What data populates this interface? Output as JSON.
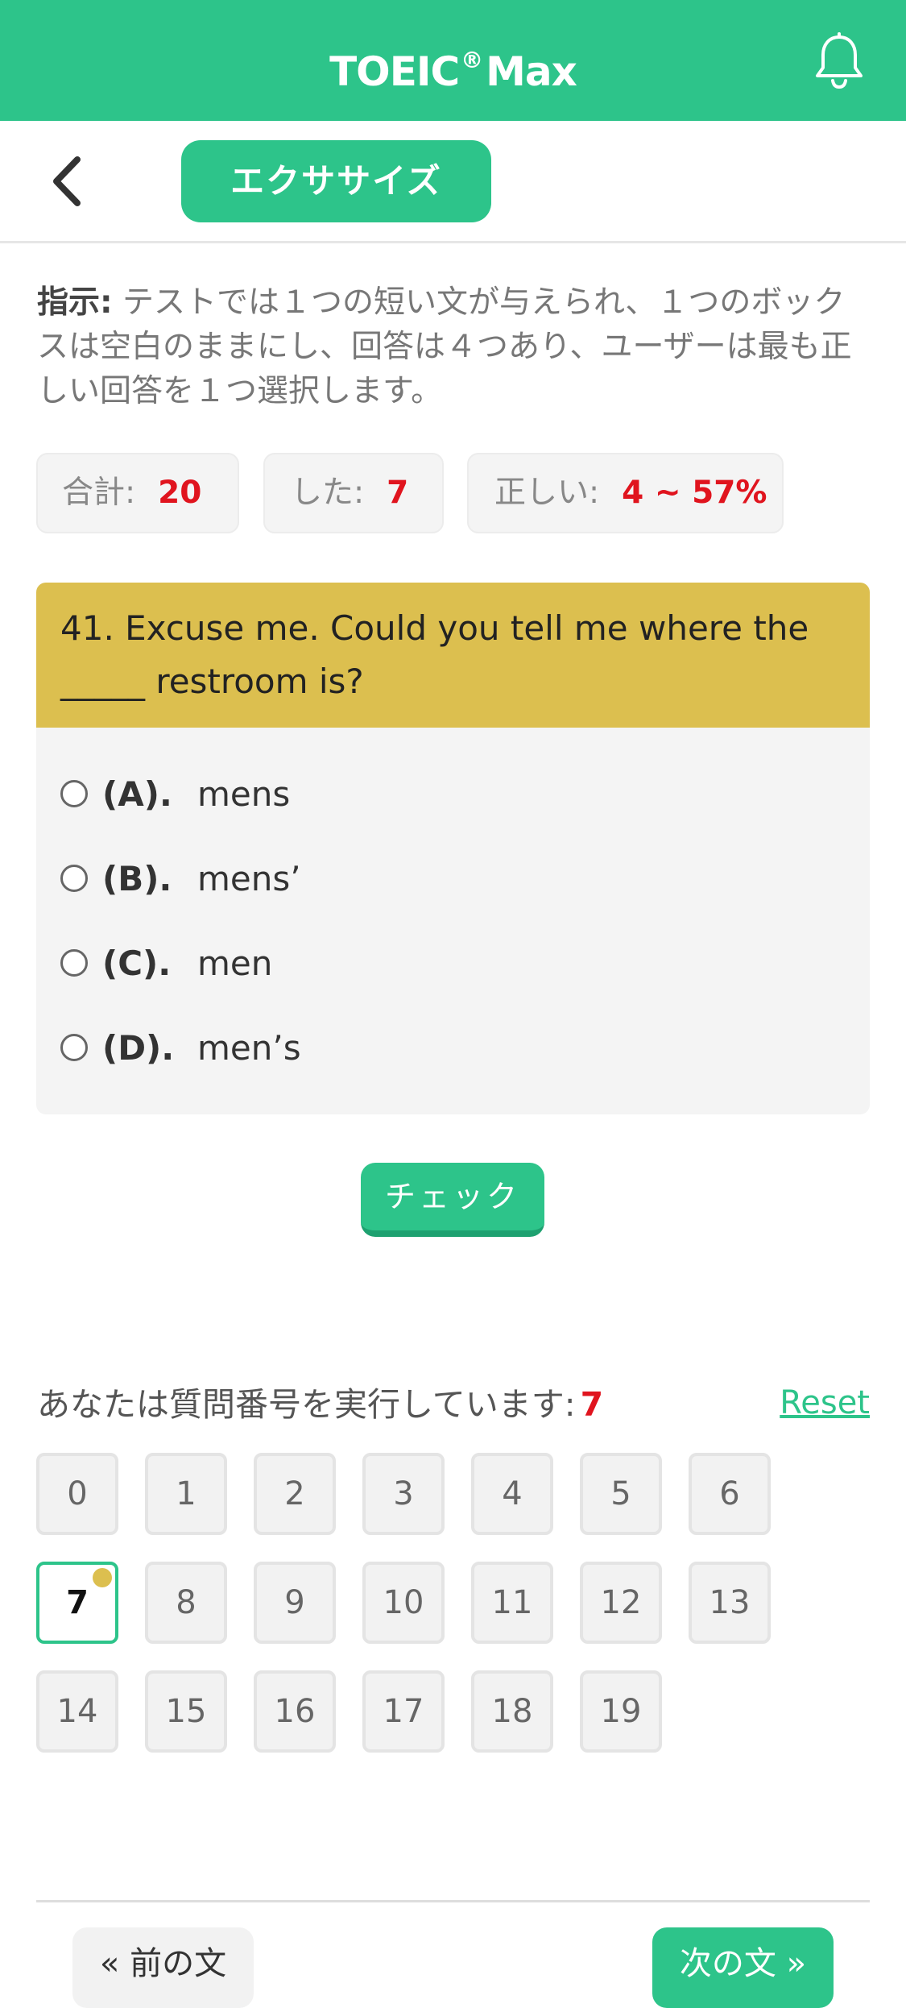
{
  "header": {
    "title_main": "TOEIC",
    "title_reg": "®",
    "title_suffix": "Max",
    "bell_icon": "bell-icon"
  },
  "nav": {
    "back_icon": "chevron-left-icon",
    "mode_label": "エクササイズ"
  },
  "instruction": {
    "label": "指示:",
    "text": " テストでは１つの短い文が与えられ、１つのボックスは空白のままにし、回答は４つあり、ユーザーは最も正しい回答を１つ選択します。"
  },
  "stats": {
    "total_label": "合計:",
    "total_value": "20",
    "done_label": "した:",
    "done_value": "7",
    "correct_label": "正しい:",
    "correct_value": "4 ~ 57%"
  },
  "question": {
    "text": "41. Excuse me. Could you tell me where the _____ restroom is?",
    "options": [
      {
        "letter": "(A).",
        "text": "mens"
      },
      {
        "letter": "(B).",
        "text": "mens’"
      },
      {
        "letter": "(C).",
        "text": "men"
      },
      {
        "letter": "(D).",
        "text": "men’s"
      }
    ]
  },
  "check_label": "チェック",
  "progress": {
    "label": "あなたは質問番号を実行しています:",
    "current": "7",
    "reset_label": "Reset",
    "numbers": [
      "0",
      "1",
      "2",
      "3",
      "4",
      "5",
      "6",
      "7",
      "8",
      "9",
      "10",
      "11",
      "12",
      "13",
      "14",
      "15",
      "16",
      "17",
      "18",
      "19"
    ],
    "current_index": 7
  },
  "footer": {
    "prev_label": "« 前の文",
    "next_label": "次の文 »"
  },
  "colors": {
    "accent": "#2dc48a",
    "question_header": "#dcbf4f",
    "highlight_red": "#e0141e"
  }
}
